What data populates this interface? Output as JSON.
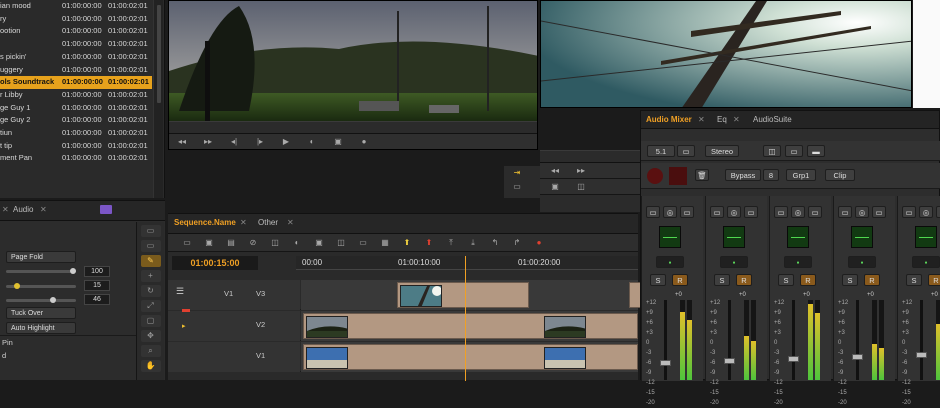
{
  "bin": {
    "rows": [
      {
        "name": "ian mood",
        "start": "01:00:00:00",
        "end": "01:00:02:01"
      },
      {
        "name": "ry",
        "start": "01:00:00:00",
        "end": "01:00:02:01"
      },
      {
        "name": "ootion",
        "start": "01:00:00:00",
        "end": "01:00:02:01"
      },
      {
        "name": "",
        "start": "01:00:00:00",
        "end": "01:00:02:01"
      },
      {
        "name": "s pickin'",
        "start": "01:00:00:00",
        "end": "01:00:02:01"
      },
      {
        "name": "uggery",
        "start": "01:00:00:00",
        "end": "01:00:02:01"
      },
      {
        "name": "ols Soundtrack",
        "start": "01:00:00:00",
        "end": "01:00:02:01",
        "selected": true
      },
      {
        "name": "r Libby",
        "start": "01:00:00:00",
        "end": "01:00:02:01"
      },
      {
        "name": "ge Guy 1",
        "start": "01:00:00:00",
        "end": "01:00:02:01"
      },
      {
        "name": "ge Guy 2",
        "start": "01:00:00:00",
        "end": "01:00:02:01"
      },
      {
        "name": "tiun",
        "start": "01:00:00:00",
        "end": "01:00:02:01"
      },
      {
        "name": "t tip",
        "start": "01:00:00:00",
        "end": "01:00:02:01"
      },
      {
        "name": "ment Pan",
        "start": "01:00:00:00",
        "end": "01:00:02:01"
      }
    ]
  },
  "effect_panel": {
    "tab_label": "Audio",
    "page_fold": "Page Fold",
    "val1": "100",
    "val2": "15",
    "val3": "46",
    "tuck_over": "Tuck Over",
    "auto_highlight": "Auto Highlight",
    "pin_label": "Pin",
    "row_label": "d"
  },
  "timeline": {
    "tab_active": "Sequence.Name",
    "tab_other": "Other",
    "timecode": "01:00:15:00",
    "ruler": [
      "00:00",
      "01:00:10:00",
      "01:00:20:00"
    ],
    "tracks": [
      {
        "label": "V1",
        "name": "V3"
      },
      {
        "label": "",
        "name": "V2"
      },
      {
        "label": "",
        "name": "V1"
      }
    ]
  },
  "mixer": {
    "tab_active": "Audio Mixer",
    "tab_eq": "Eq",
    "tab_suite": "AudioSuite",
    "format": "5.1",
    "mode": "Stereo",
    "bypass": "Bypass",
    "bypass_num": "8",
    "group": "Grp1",
    "clip": "Clip",
    "scale": [
      "+12",
      "+9",
      "+6",
      "+3",
      "0",
      "-3",
      "-6",
      "-9",
      "-12",
      "-15",
      "-20"
    ],
    "meter_labels": [
      "+0",
      "+0",
      "+0",
      "+0",
      "+0"
    ]
  },
  "colors": {
    "accent": "#f0a024",
    "selected_row": "#e7a21c",
    "clip": "#b39882"
  }
}
